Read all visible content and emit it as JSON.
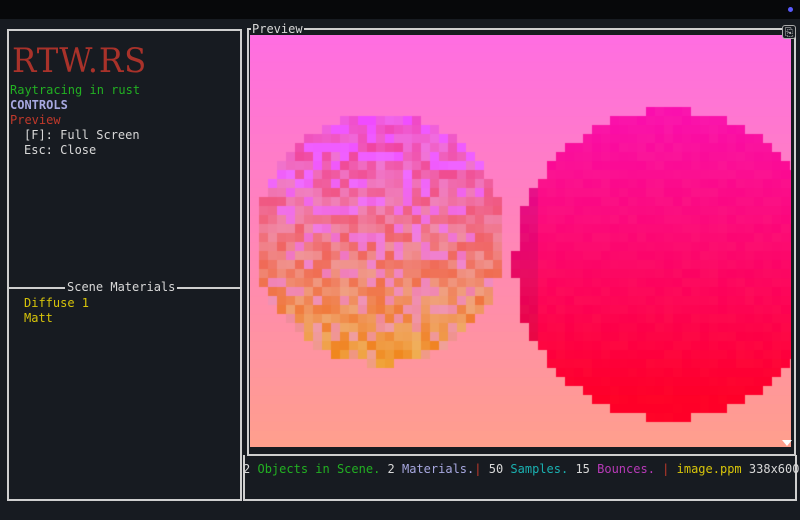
{
  "logo": "RTW.RS",
  "sidebar": {
    "subtitle": "Raytracing in rust",
    "controls_heading": "CONTROLS",
    "section": "Preview",
    "controls": [
      "[F]: Full Screen",
      "Esc: Close"
    ],
    "materials_title": "Scene Materials",
    "materials": [
      "Diffuse 1",
      "Matt"
    ]
  },
  "preview": {
    "title": "Preview",
    "copy_icon": "clipboard-icon",
    "scroll_icon": "triangle-down-icon"
  },
  "status": {
    "objects_count": "2",
    "objects_label": "Objects in Scene.",
    "materials_count": "2",
    "materials_label": "Materials.",
    "sep": "|",
    "samples_count": "50",
    "samples_label": "Samples.",
    "bounces_count": "15",
    "bounces_label": "Bounces.",
    "file": "image.ppm",
    "resolution": "338x600"
  },
  "colors": {
    "accent_red": "#c0392b",
    "green": "#22b022",
    "lavender": "#a7a8e0",
    "yellow": "#d7c40a",
    "cyan": "#1ab0b0",
    "magenta": "#b83ab8"
  }
}
